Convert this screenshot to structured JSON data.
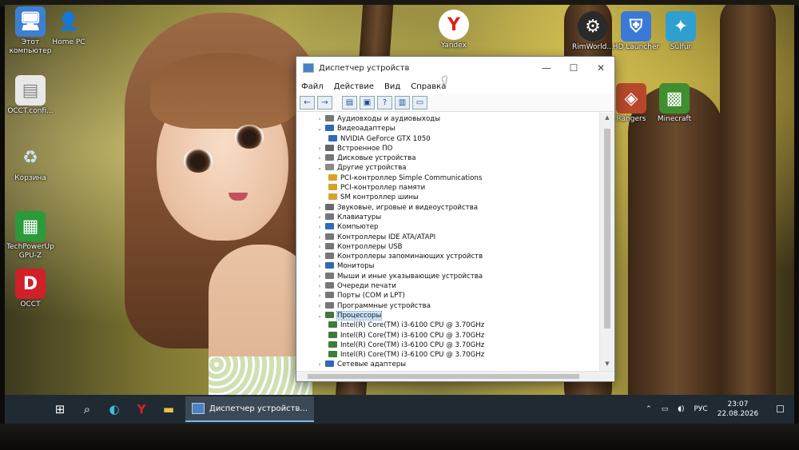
{
  "desktop": {
    "icons": [
      {
        "id": "this-pc",
        "label": "Этот компьютер",
        "glyph": "🖥",
        "color": "#3d7fd1"
      },
      {
        "id": "home-pc",
        "label": "Home PC",
        "glyph": "👤",
        "color": "#f0c040"
      },
      {
        "id": "occt-config",
        "label": "OCCT.confi...",
        "glyph": "▤",
        "color": "#e8e8e8"
      },
      {
        "id": "recycle",
        "label": "Корзина",
        "glyph": "♻",
        "color": "#8fb8e0"
      },
      {
        "id": "gpuz",
        "label": "TechPowerUp GPU-Z",
        "glyph": "▦",
        "color": "#2b9a3a"
      },
      {
        "id": "occt",
        "label": "OCCT",
        "glyph": "D",
        "color": "#d0202a"
      },
      {
        "id": "yandex",
        "label": "Yandex",
        "glyph": "Y",
        "color": "#ffffff"
      },
      {
        "id": "rimworld",
        "label": "RimWorld...",
        "glyph": "⚙",
        "color": "#2a2a2a"
      },
      {
        "id": "hd-launcher",
        "label": "HD Launcher",
        "glyph": "⛨",
        "color": "#3a7ad6"
      },
      {
        "id": "sulfur",
        "label": "Sulfur",
        "glyph": "✦",
        "color": "#2f9fd0"
      },
      {
        "id": "rangers",
        "label": "Rangers",
        "glyph": "◈",
        "color": "#b5482b"
      },
      {
        "id": "minecraft",
        "label": "Minecraft",
        "glyph": "▩",
        "color": "#3f8f2e"
      }
    ]
  },
  "window": {
    "title": "Диспетчер устройств",
    "menu": [
      "Файл",
      "Действие",
      "Вид",
      "Справка"
    ],
    "controls": {
      "minimize": "—",
      "maximize": "☐",
      "close": "✕"
    },
    "toolbar_icons": [
      "back-arrow-icon",
      "forward-arrow-icon",
      "properties-icon",
      "update-driver-icon",
      "help-icon",
      "view-icon",
      "monitor-icon"
    ],
    "tree": [
      {
        "level": 0,
        "expander": "›",
        "label": "Аудиовходы и аудиовыходы",
        "icon_color": "#777"
      },
      {
        "level": 0,
        "expander": "⌄",
        "label": "Видеоадаптеры",
        "icon_color": "#2f6bb5"
      },
      {
        "level": 1,
        "expander": "",
        "label": "NVIDIA GeForce GTX 1050",
        "icon_color": "#2f6bb5"
      },
      {
        "level": 0,
        "expander": "›",
        "label": "Встроенное ПО",
        "icon_color": "#666"
      },
      {
        "level": 0,
        "expander": "›",
        "label": "Дисковые устройства",
        "icon_color": "#777"
      },
      {
        "level": 0,
        "expander": "⌄",
        "label": "Другие устройства",
        "icon_color": "#8a8a8a"
      },
      {
        "level": 1,
        "expander": "",
        "label": "PCI-контроллер Simple Communications",
        "icon_color": "#d9a12b"
      },
      {
        "level": 1,
        "expander": "",
        "label": "PCI-контроллер памяти",
        "icon_color": "#d9a12b"
      },
      {
        "level": 1,
        "expander": "",
        "label": "SM контроллер шины",
        "icon_color": "#d9a12b"
      },
      {
        "level": 0,
        "expander": "›",
        "label": "Звуковые, игровые и видеоустройства",
        "icon_color": "#6a6a6a"
      },
      {
        "level": 0,
        "expander": "›",
        "label": "Клавиатуры",
        "icon_color": "#777"
      },
      {
        "level": 0,
        "expander": "›",
        "label": "Компьютер",
        "icon_color": "#2f6bb5"
      },
      {
        "level": 0,
        "expander": "›",
        "label": "Контроллеры IDE ATA/ATAPI",
        "icon_color": "#777"
      },
      {
        "level": 0,
        "expander": "›",
        "label": "Контроллеры USB",
        "icon_color": "#777"
      },
      {
        "level": 0,
        "expander": "›",
        "label": "Контроллеры запоминающих устройств",
        "icon_color": "#777"
      },
      {
        "level": 0,
        "expander": "›",
        "label": "Мониторы",
        "icon_color": "#2f6bb5"
      },
      {
        "level": 0,
        "expander": "›",
        "label": "Мыши и иные указывающие устройства",
        "icon_color": "#777"
      },
      {
        "level": 0,
        "expander": "›",
        "label": "Очереди печати",
        "icon_color": "#777"
      },
      {
        "level": 0,
        "expander": "›",
        "label": "Порты (COM и LPT)",
        "icon_color": "#777"
      },
      {
        "level": 0,
        "expander": "›",
        "label": "Программные устройства",
        "icon_color": "#777"
      },
      {
        "level": 0,
        "expander": "⌄",
        "label": "Процессоры",
        "icon_color": "#3f7a3a",
        "selected": true
      },
      {
        "level": 1,
        "expander": "",
        "label": "Intel(R) Core(TM) i3-6100 CPU @ 3.70GHz",
        "icon_color": "#3f7a3a"
      },
      {
        "level": 1,
        "expander": "",
        "label": "Intel(R) Core(TM) i3-6100 CPU @ 3.70GHz",
        "icon_color": "#3f7a3a"
      },
      {
        "level": 1,
        "expander": "",
        "label": "Intel(R) Core(TM) i3-6100 CPU @ 3.70GHz",
        "icon_color": "#3f7a3a"
      },
      {
        "level": 1,
        "expander": "",
        "label": "Intel(R) Core(TM) i3-6100 CPU @ 3.70GHz",
        "icon_color": "#3f7a3a"
      },
      {
        "level": 0,
        "expander": "›",
        "label": "Сетевые адаптеры",
        "icon_color": "#2f6bb5"
      }
    ]
  },
  "taskbar": {
    "start": "⊞",
    "search": "⌕",
    "pinned": [
      {
        "id": "edge",
        "glyph": "◐"
      },
      {
        "id": "yandex",
        "glyph": "Y"
      },
      {
        "id": "explorer",
        "glyph": "▬"
      }
    ],
    "active_task": "Диспетчер устройств...",
    "tray": {
      "chevron": "⌃",
      "lang": "РУС",
      "time": "23:07",
      "date": "22.08.2026",
      "notifications": "☐"
    }
  }
}
